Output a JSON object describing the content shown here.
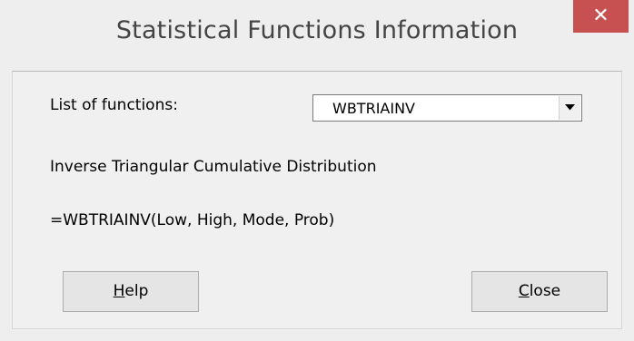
{
  "window": {
    "title": "Statistical Functions Information",
    "close_glyph": "✕"
  },
  "form": {
    "list_label": "List of functions:",
    "selected_function": "WBTRIAINV",
    "description": "Inverse Triangular Cumulative Distribution",
    "formula": "=WBTRIAINV(Low, High, Mode, Prob)"
  },
  "buttons": {
    "help_accel": "H",
    "help_rest": "elp",
    "close_accel": "C",
    "close_rest": "lose"
  },
  "colors": {
    "close_button_bg": "#c75050",
    "window_bg": "#eeeeee",
    "client_bg": "#f0f0f0"
  },
  "icons": {
    "close": "close-icon",
    "dropdown": "chevron-down-icon"
  }
}
